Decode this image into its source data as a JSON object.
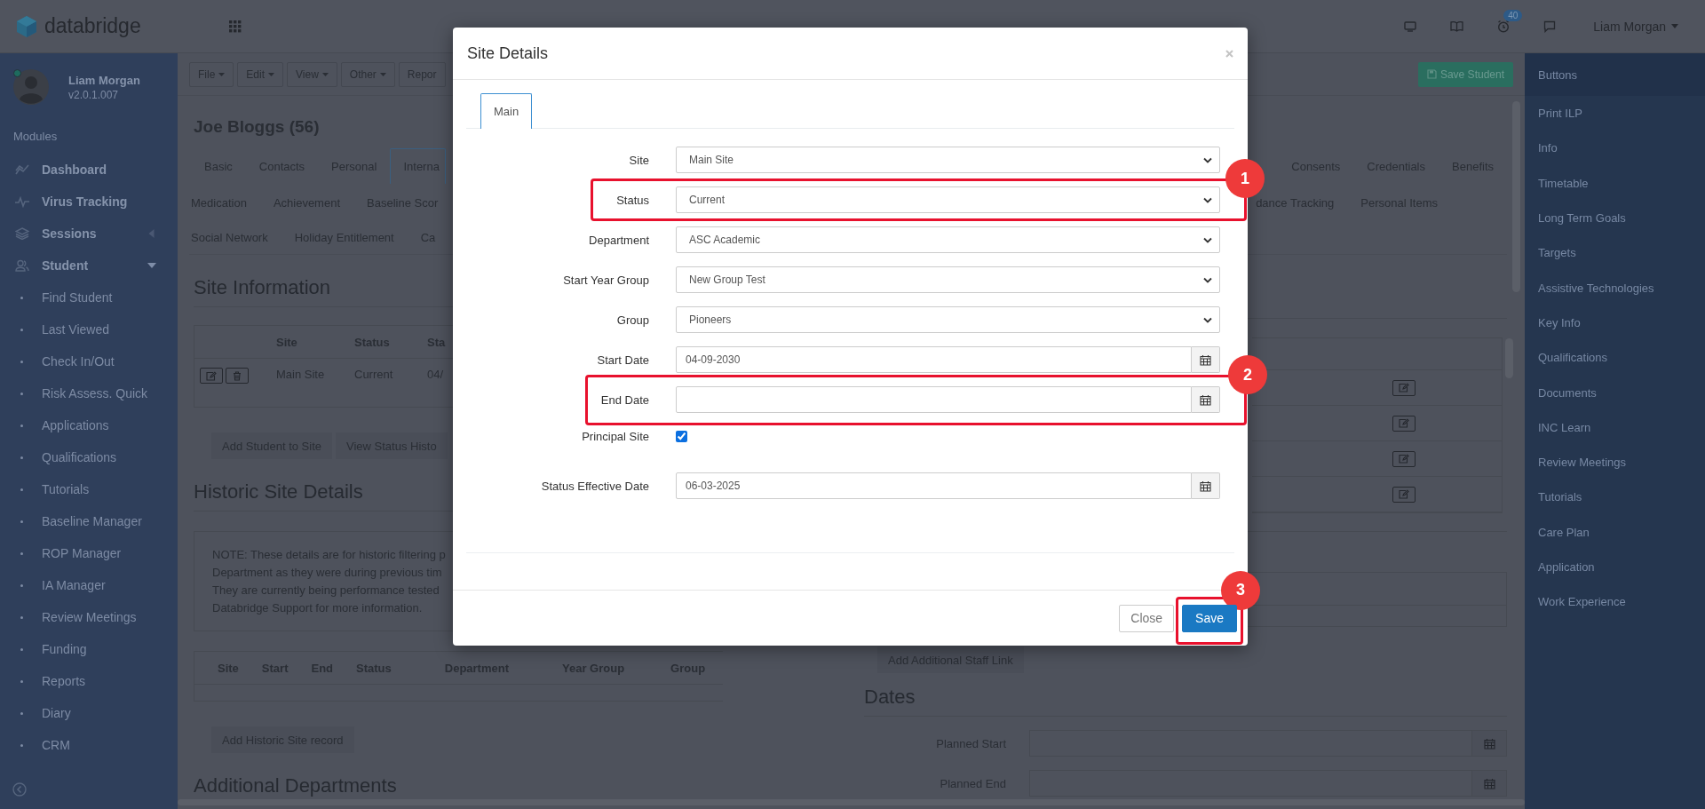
{
  "top_bar": {
    "logo_text": "databridge",
    "alarm_badge": "40",
    "user_name": "Liam Morgan"
  },
  "sidebar": {
    "profile": {
      "name": "Liam Morgan",
      "version": "v2.0.1.007",
      "online": true
    },
    "section_title": "Modules",
    "items": [
      {
        "label": "Dashboard"
      },
      {
        "label": "Virus Tracking"
      },
      {
        "label": "Sessions",
        "expanded": false
      },
      {
        "label": "Student",
        "expanded": true,
        "children": [
          {
            "label": "Find Student"
          },
          {
            "label": "Last Viewed"
          },
          {
            "label": "Check In/Out"
          },
          {
            "label": "Risk Assess. Quick"
          },
          {
            "label": "Applications"
          },
          {
            "label": "Qualifications"
          },
          {
            "label": "Tutorials"
          },
          {
            "label": "Baseline Manager"
          },
          {
            "label": "ROP Manager"
          },
          {
            "label": "IA Manager"
          },
          {
            "label": "Review Meetings"
          },
          {
            "label": "Funding"
          },
          {
            "label": "Reports"
          },
          {
            "label": "Diary"
          },
          {
            "label": "CRM"
          }
        ]
      }
    ]
  },
  "toolbar": {
    "menus": [
      {
        "label": "File",
        "dropdown": true
      },
      {
        "label": "Edit",
        "dropdown": true
      },
      {
        "label": "View",
        "dropdown": true
      },
      {
        "label": "Other",
        "dropdown": true
      },
      {
        "label": "Repor",
        "dropdown": false
      }
    ],
    "save_button": "Save Student"
  },
  "student_title": "Joe Bloggs (56)",
  "tab_rows": [
    {
      "tabs": [
        {
          "label": "Basic",
          "selected": false
        },
        {
          "label": "Contacts",
          "selected": false
        },
        {
          "label": "Personal",
          "selected": false
        },
        {
          "label": "Interna",
          "selected": true
        }
      ],
      "tabs_right": [
        {
          "label": "Consents",
          "selected": false
        },
        {
          "label": "Credentials",
          "selected": false
        },
        {
          "label": "Benefits",
          "selected": false
        }
      ]
    },
    {
      "tabs": [
        {
          "label": "Medication",
          "selected": false
        },
        {
          "label": "Achievement",
          "selected": false
        },
        {
          "label": "Baseline Scor",
          "selected": false
        }
      ],
      "tabs_right": [
        {
          "label": "dance Tracking",
          "selected": false
        },
        {
          "label": "Personal Items",
          "selected": false
        }
      ]
    },
    {
      "tabs": [
        {
          "label": "Social Network",
          "selected": false
        },
        {
          "label": "Holiday Entitlement",
          "selected": false
        },
        {
          "label": "Ca",
          "selected": false
        }
      ],
      "tabs_right": []
    }
  ],
  "site_information": {
    "title": "Site Information",
    "columns": [
      "Site",
      "Status",
      "Sta"
    ],
    "rows": [
      {
        "cells": [
          "Main Site",
          "Current",
          "04/"
        ]
      }
    ],
    "buttons": [
      "Add Student to Site",
      "View Status Histo"
    ]
  },
  "historic": {
    "title": "Historic Site Details",
    "note_lines": [
      "NOTE: These details are for historic filtering p",
      "Department as they were during previous tim",
      "They are currently being performance tested",
      "Databridge Support for more information."
    ],
    "columns": [
      "Site",
      "Start",
      "End",
      "Status",
      "Department",
      "Year Group",
      "Group"
    ],
    "button": "Add Historic Site record"
  },
  "additional_departments": {
    "title": "Additional Departments"
  },
  "staff": {
    "button": "Add Additional Staff Link"
  },
  "dates": {
    "title": "Dates",
    "fields": [
      {
        "label": "Planned Start"
      },
      {
        "label": "Planned End"
      }
    ]
  },
  "right_sidebar": {
    "title": "Buttons",
    "items": [
      "Print ILP",
      "Info",
      "Timetable",
      "Long Term Goals",
      "Targets",
      "Assistive Technologies",
      "Key Info",
      "Qualifications",
      "Documents",
      "INC Learn",
      "Review Meetings",
      "Tutorials",
      "Care Plan",
      "Application",
      "Work Experience"
    ]
  },
  "modal": {
    "title": "Site Details",
    "tabs": [
      {
        "label": "Main",
        "selected": true
      }
    ],
    "fields": [
      {
        "kind": "select",
        "label": "Site",
        "value": "Main Site"
      },
      {
        "kind": "select",
        "label": "Status",
        "value": "Current",
        "callout": "1"
      },
      {
        "kind": "select",
        "label": "Department",
        "value": "ASC Academic"
      },
      {
        "kind": "select",
        "label": "Start Year Group",
        "value": "New Group Test"
      },
      {
        "kind": "select",
        "label": "Group",
        "value": "Pioneers"
      },
      {
        "kind": "date",
        "label": "Start Date",
        "value": "04-09-2030"
      },
      {
        "kind": "date",
        "label": "End Date",
        "callout": "2"
      },
      {
        "kind": "checkbox",
        "label": "Principal Site",
        "checked": true
      },
      {
        "kind": "date",
        "label": "Status Effective Date",
        "value": "06-03-2025"
      }
    ],
    "buttons": [
      {
        "label": "Close",
        "kind": "default"
      },
      {
        "label": "Save",
        "kind": "primary",
        "callout": "3"
      }
    ]
  }
}
